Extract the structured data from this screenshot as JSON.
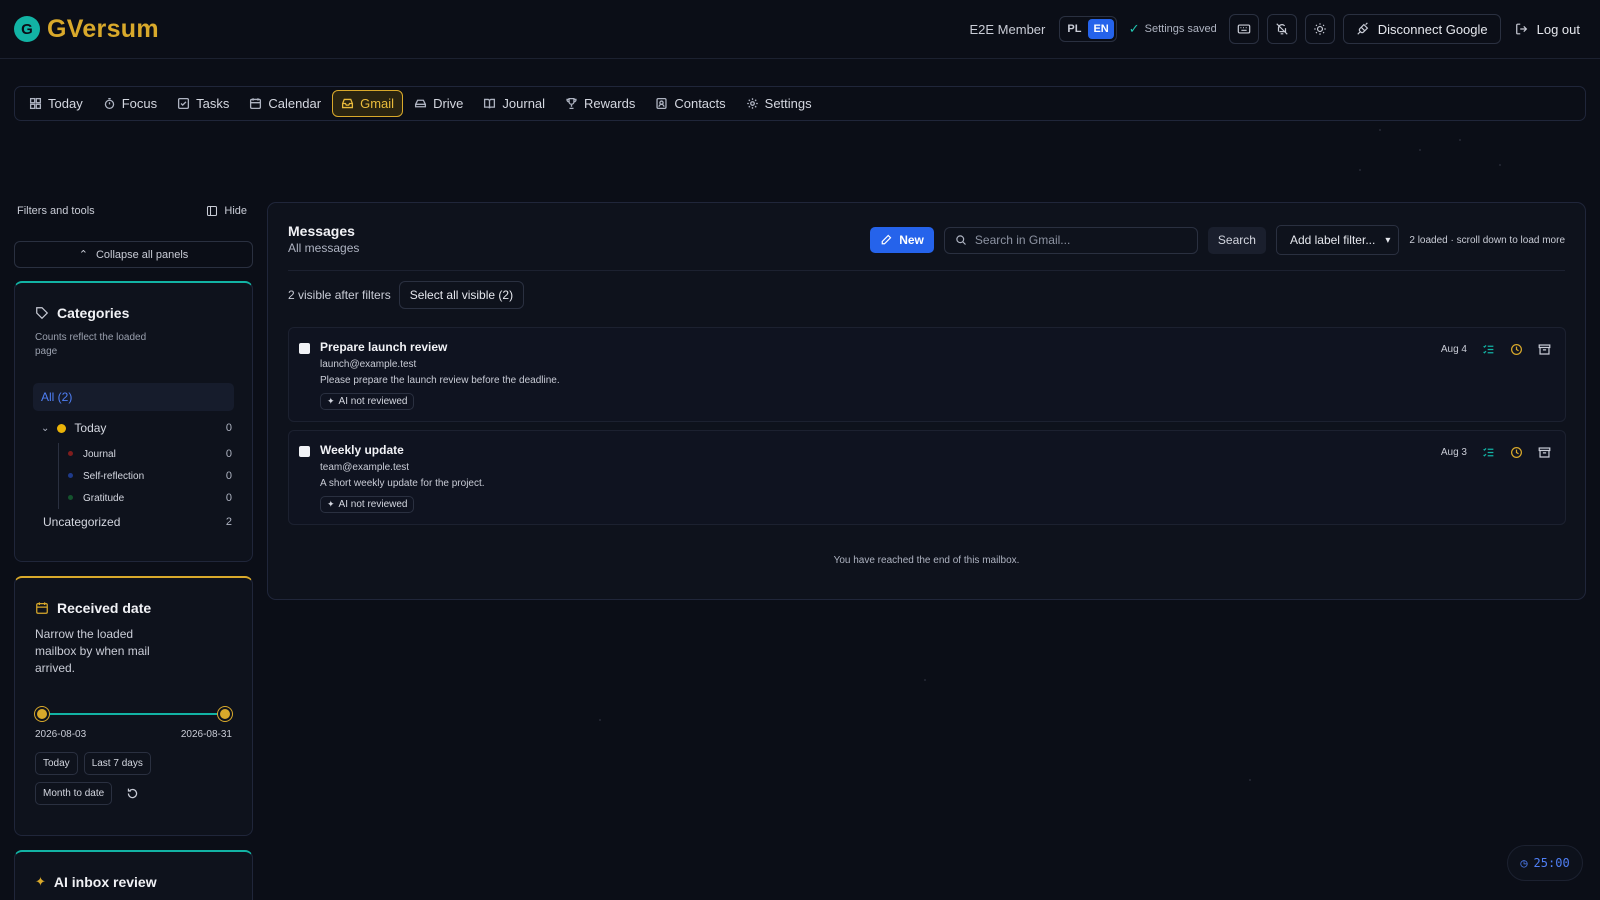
{
  "header": {
    "logo_letter": "G",
    "app_name": "GVersum",
    "member": "E2E Member",
    "lang_pl": "PL",
    "lang_en": "EN",
    "settings_saved": "Settings saved",
    "disconnect": "Disconnect Google",
    "logout": "Log out"
  },
  "nav": {
    "items": [
      {
        "label": "Today",
        "icon": "grid-icon"
      },
      {
        "label": "Focus",
        "icon": "timer-icon"
      },
      {
        "label": "Tasks",
        "icon": "check-square-icon"
      },
      {
        "label": "Calendar",
        "icon": "calendar-icon"
      },
      {
        "label": "Gmail",
        "icon": "mail-icon",
        "active": true
      },
      {
        "label": "Drive",
        "icon": "drive-icon"
      },
      {
        "label": "Journal",
        "icon": "book-icon"
      },
      {
        "label": "Rewards",
        "icon": "trophy-icon"
      },
      {
        "label": "Contacts",
        "icon": "contact-icon"
      },
      {
        "label": "Settings",
        "icon": "gear-icon"
      }
    ]
  },
  "sidebar": {
    "title": "Filters and tools",
    "hide": "Hide",
    "collapse_all": "Collapse all panels",
    "categories": {
      "title": "Categories",
      "subtitle": "Counts reflect the loaded page",
      "all": "All (2)",
      "today": {
        "label": "Today",
        "count": "0",
        "color": "#eab308"
      },
      "subs": [
        {
          "label": "Journal",
          "count": "0",
          "color": "#7f1d1d"
        },
        {
          "label": "Self-reflection",
          "count": "0",
          "color": "#1e3a8a"
        },
        {
          "label": "Gratitude",
          "count": "0",
          "color": "#14532d"
        }
      ],
      "uncategorized": {
        "label": "Uncategorized",
        "count": "2"
      }
    },
    "received": {
      "title": "Received date",
      "subtitle": "Narrow the loaded mailbox by when mail arrived.",
      "from": "2026-08-03",
      "to": "2026-08-31",
      "range_start_fraction": 0.0,
      "range_end_fraction": 1.0,
      "chips": [
        "Today",
        "Last 7 days",
        "Month to date"
      ]
    },
    "ai_review": {
      "title": "AI inbox review"
    }
  },
  "messages": {
    "title": "Messages",
    "subtitle": "All messages",
    "new_label": "New",
    "search_placeholder": "Search in Gmail...",
    "search_label": "Search",
    "label_filter": "Add label filter...",
    "loaded_note": "2 loaded · scroll down to load more",
    "visible_note": "2 visible after filters",
    "select_all": "Select all visible (2)",
    "emails": [
      {
        "subject": "Prepare launch review",
        "from": "launch@example.test",
        "preview": "Please prepare the launch review before the deadline.",
        "badge": "AI not reviewed",
        "date": "Aug 4"
      },
      {
        "subject": "Weekly update",
        "from": "team@example.test",
        "preview": "A short weekly update for the project.",
        "badge": "AI not reviewed",
        "date": "Aug 3"
      }
    ],
    "end_note": "You have reached the end of this mailbox."
  },
  "timer": {
    "value": "25:00"
  },
  "colors": {
    "accent": "#2563eb",
    "brand": "#d9a92b",
    "teal": "#12b3a4",
    "background": "#0b0e17"
  }
}
